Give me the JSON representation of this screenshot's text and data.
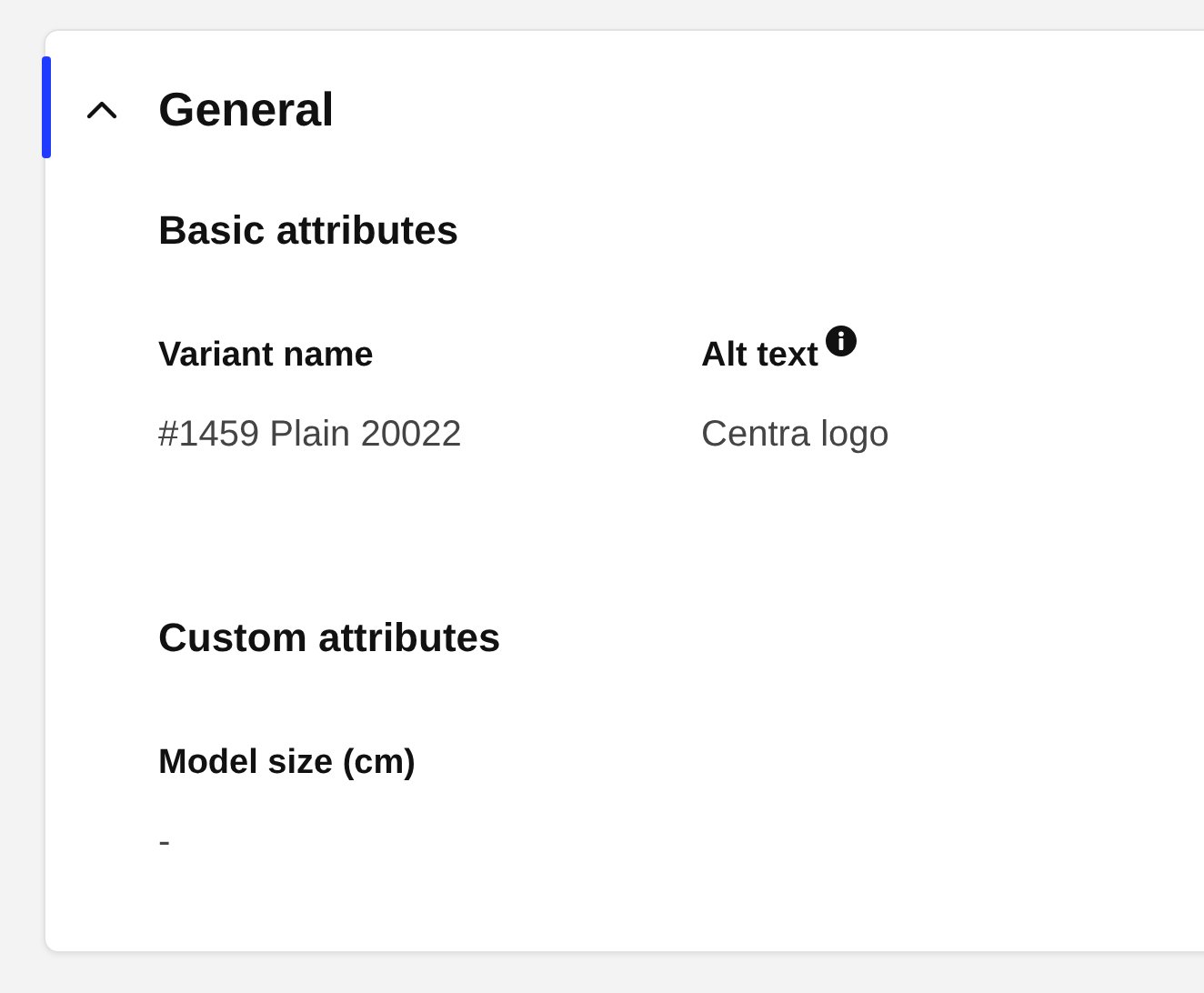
{
  "section": {
    "title": "General",
    "expanded": true,
    "groups": [
      {
        "title": "Basic attributes",
        "fields": [
          {
            "label": "Variant name",
            "value": "#1459 Plain 20022"
          },
          {
            "label": "Alt text",
            "value": "Centra logo",
            "info": true
          }
        ]
      },
      {
        "title": "Custom attributes",
        "fields": [
          {
            "label": "Model size (cm)",
            "value": "-"
          }
        ]
      }
    ]
  }
}
